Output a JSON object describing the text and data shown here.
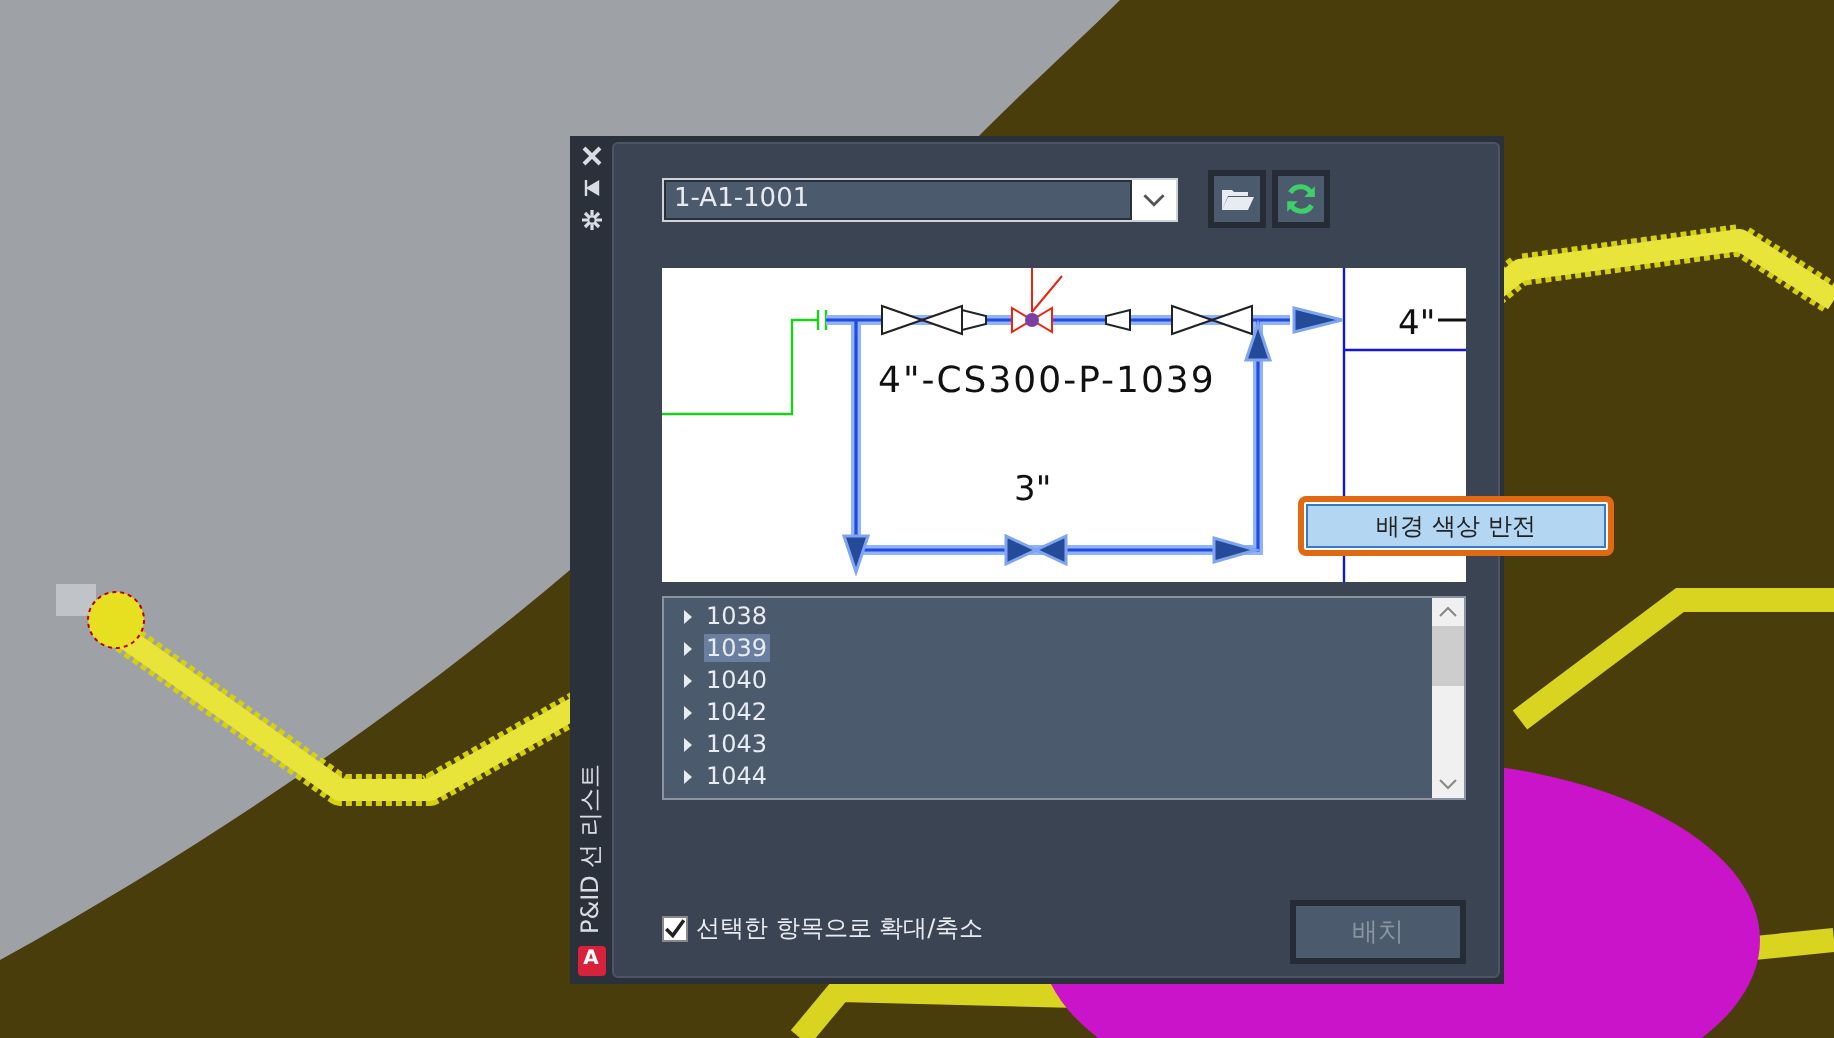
{
  "palette": {
    "title": "P&ID 선 리스트",
    "logo": "A"
  },
  "drawing_select": {
    "value": "1-A1-1001"
  },
  "preview": {
    "labels": [
      {
        "kind": "line",
        "text": "4\"-CS300-P-1039"
      },
      {
        "kind": "size",
        "text": "3\""
      },
      {
        "kind": "edge",
        "text": "4\""
      }
    ]
  },
  "context_menu": {
    "items": [
      {
        "label": "배경 색상 반전",
        "selected": true
      }
    ]
  },
  "lines": [
    {
      "label": "1038",
      "selected": false
    },
    {
      "label": "1039",
      "selected": true
    },
    {
      "label": "1040",
      "selected": false
    },
    {
      "label": "1042",
      "selected": false
    },
    {
      "label": "1043",
      "selected": false
    },
    {
      "label": "1044",
      "selected": false
    }
  ],
  "zoom_option": {
    "label": "선택한 항목으로 확대/축소",
    "checked": true
  },
  "place_button": {
    "label": "배치",
    "disabled": true
  }
}
